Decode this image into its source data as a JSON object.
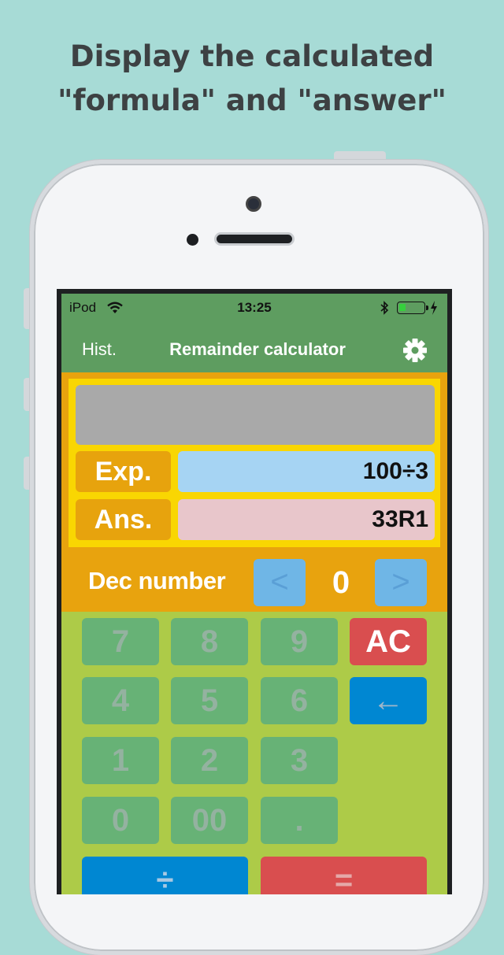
{
  "headline": {
    "line1": "Display the calculated",
    "line2": "\"formula\" and \"answer\""
  },
  "status_bar": {
    "carrier": "iPod",
    "time": "13:25",
    "battery_level": 0.26
  },
  "nav": {
    "history_label": "Hist.",
    "title": "Remainder calculator",
    "settings_icon": "gear-icon"
  },
  "display": {
    "formula_text": "",
    "expression_label": "Exp.",
    "expression_value": "100÷3",
    "answer_label": "Ans.",
    "answer_value": "33R1"
  },
  "decimal": {
    "label": "Dec number",
    "decrease_label": "<",
    "value": "0",
    "increase_label": ">"
  },
  "keypad": {
    "k7": "7",
    "k8": "8",
    "k9": "9",
    "ac": "AC",
    "k4": "4",
    "k5": "5",
    "k6": "6",
    "back": "←",
    "k1": "1",
    "k2": "2",
    "k3": "3",
    "k0": "0",
    "k00": "00",
    "dot": ".",
    "divide": "÷",
    "equals": "="
  },
  "colors": {
    "background": "#a7dbd6",
    "nav_green": "#5e9d60",
    "display_orange": "#e8a30e",
    "display_yellow": "#f9d602",
    "expression_blue": "#a6d4f3",
    "answer_pink": "#e8c6cb",
    "keypad_green": "#adcb48",
    "key_green": "#67b276",
    "ac_red": "#d94e4f",
    "back_blue": "#0087d2"
  }
}
